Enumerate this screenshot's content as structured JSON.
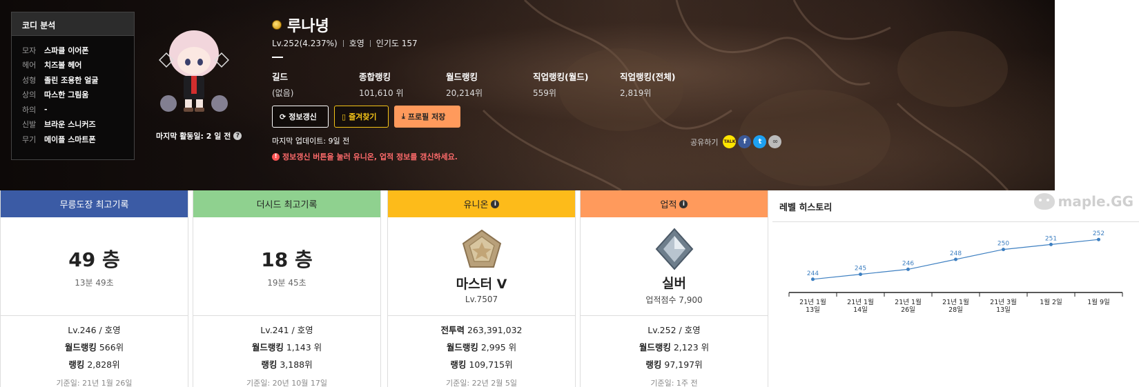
{
  "coordi": {
    "title": "코디 분석",
    "items": [
      {
        "k": "모자",
        "v": "스파클 이어폰"
      },
      {
        "k": "헤어",
        "v": "치즈볼 헤어"
      },
      {
        "k": "성형",
        "v": "졸린 조용한 얼굴"
      },
      {
        "k": "상의",
        "v": "따스한 그림움"
      },
      {
        "k": "하의",
        "v": "-"
      },
      {
        "k": "신발",
        "v": "브라운 스니커즈"
      },
      {
        "k": "무기",
        "v": "메이플 스마트폰"
      }
    ]
  },
  "character": {
    "last_active": "마지막 활동일: 2 일 전",
    "name": "루나녕",
    "level": "Lv.252(4.237%)",
    "job": "호영",
    "popularity": "인기도 157"
  },
  "stats": [
    {
      "label": "길드",
      "value": "(없음)"
    },
    {
      "label": "종합랭킹",
      "value": "101,610 위"
    },
    {
      "label": "월드랭킹",
      "value": "20,214위"
    },
    {
      "label": "직업랭킹(월드)",
      "value": "559위"
    },
    {
      "label": "직업랭킹(전체)",
      "value": "2,819위"
    }
  ],
  "buttons": {
    "refresh": "정보갱신",
    "favorite": "즐겨찾기",
    "save_profile": "프로필 저장"
  },
  "last_update": "마지막 업데이트: 9일 전",
  "warning": "정보갱신 버튼을 눌러 유니온, 업적 정보를 갱신하세요.",
  "share": {
    "label": "공유하기",
    "kakao_text": "TALK"
  },
  "cards": {
    "mureung": {
      "title": "무릉도장 최고기록",
      "big": "49 층",
      "sub": "13분 49초",
      "line1": "Lv.246 / 호영",
      "world_rank_label": "월드랭킹",
      "world_rank": "566위",
      "rank_label": "랭킹",
      "rank": "2,828위",
      "basis": "기준일: 21년 1월 26일",
      "color": "#3b5ba5"
    },
    "theseed": {
      "title": "더시드 최고기록",
      "big": "18 층",
      "sub": "19분 45초",
      "line1": "Lv.241 / 호영",
      "world_rank_label": "월드랭킹",
      "world_rank": "1,143 위",
      "rank_label": "랭킹",
      "rank": "3,188위",
      "basis": "기준일: 20년 10월 17일",
      "color": "#8fd18f"
    },
    "union": {
      "title": "유니온",
      "name": "마스터 V",
      "sub": "Lv.7507",
      "power_label": "전투력",
      "power": "263,391,032",
      "world_rank_label": "월드랭킹",
      "world_rank": "2,995 위",
      "rank_label": "랭킹",
      "rank": "109,715위",
      "basis": "기준일: 22년 2월 5일",
      "color": "#fdbb1a"
    },
    "achievement": {
      "title": "업적",
      "name": "실버",
      "sub": "업적점수 7,900",
      "line1": "Lv.252 / 호영",
      "world_rank_label": "월드랭킹",
      "world_rank": "2,123 위",
      "rank_label": "랭킹",
      "rank": "97,197위",
      "basis": "기준일: 1주 전",
      "color": "#ff9a5c"
    }
  },
  "history": {
    "title": "레벨 히스토리",
    "logo": "maple.GG"
  },
  "chart_data": {
    "type": "line",
    "categories": [
      "21년 1월 13일",
      "21년 1월 14일",
      "21년 1월 26일",
      "21년 1월 28일",
      "21년 3월 13일",
      "1월 2일",
      "1월 9일"
    ],
    "values": [
      244,
      245,
      246,
      248,
      250,
      251,
      252
    ],
    "title": "",
    "xlabel": "",
    "ylabel": "",
    "ylim": [
      243,
      253
    ],
    "grid": false,
    "color": "#3d7fc1"
  }
}
